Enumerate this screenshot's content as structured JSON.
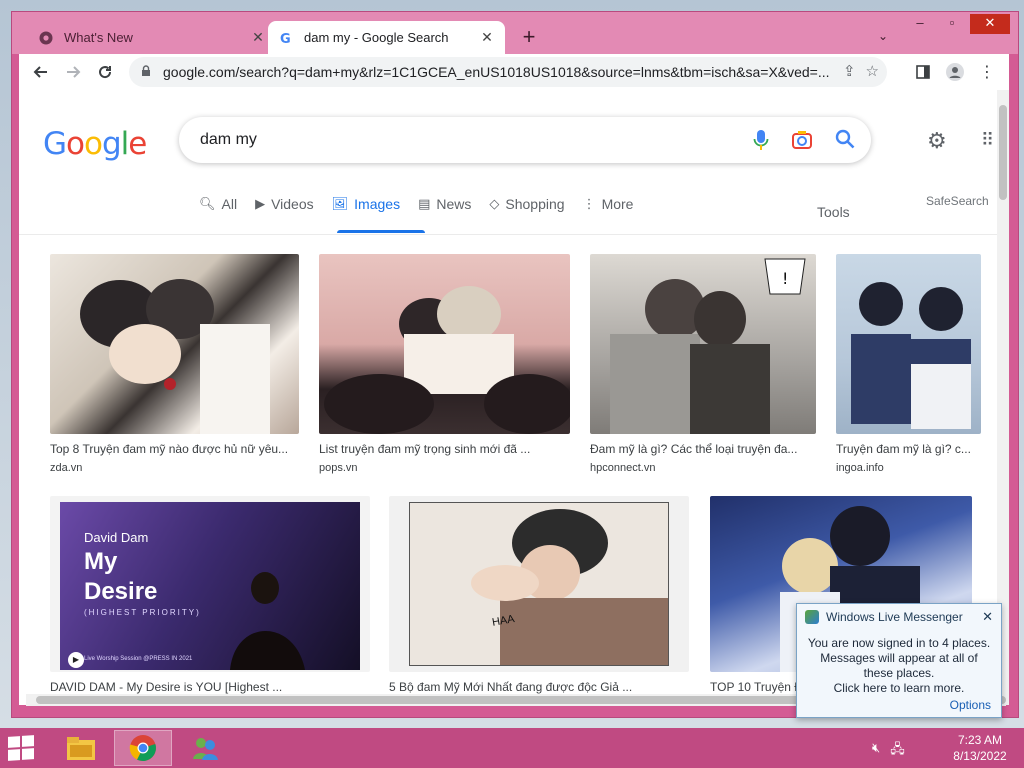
{
  "browser": {
    "tabs": [
      {
        "title": "What's New",
        "active": false
      },
      {
        "title": "dam my - Google Search",
        "active": true
      }
    ],
    "url": "google.com/search?q=dam+my&rlz=1C1GCEA_enUS1018US1018&source=lnms&tbm=isch&sa=X&ved=..."
  },
  "google": {
    "logo": "Google",
    "query": "dam my",
    "tabs": [
      "All",
      "Videos",
      "Images",
      "News",
      "Shopping",
      "More"
    ],
    "active_tab": "Images",
    "tools": "Tools",
    "safesearch": "SafeSearch"
  },
  "results": [
    {
      "caption": "Top 8 Truyện đam mỹ nào được hủ nữ yêu...",
      "source": "zda.vn"
    },
    {
      "caption": "List truyện đam mỹ trọng sinh mới đã ...",
      "source": "pops.vn"
    },
    {
      "caption": "Đam mỹ là gì? Các thể loại truyện đa...",
      "source": "hpconnect.vn"
    },
    {
      "caption": "Truyện đam mỹ là gì? c...",
      "source": "ingoa.info"
    },
    {
      "caption": "DAVID DAM - My Desire is YOU [Highest ...",
      "source": ""
    },
    {
      "caption": "5 Bộ đam Mỹ Mới Nhất đang được độc Giả ...",
      "source": ""
    },
    {
      "caption": "TOP 10 Truyện Đam Mỹ",
      "source": ""
    }
  ],
  "video_thumb": {
    "artist": "David Dam",
    "title_line1": "My",
    "title_line2": "Desire",
    "subtitle": "(HIGHEST PRIORITY)",
    "footer": "Live Worship Session @PRESS IN 2021"
  },
  "manga_bubble": "HAA",
  "messenger": {
    "title": "Windows Live Messenger",
    "message": "You are now signed in to 4 places. Messages will appear at all of these places.",
    "link": "Click here to learn more.",
    "options": "Options"
  },
  "taskbar": {
    "time": "7:23 AM",
    "date": "8/13/2022"
  },
  "colors": {
    "window_frame": "#d45b94",
    "google_blue": "#4285f4",
    "google_red": "#ea4335",
    "google_yellow": "#fbbc05",
    "google_green": "#34a853",
    "active_tab": "#1a73e8"
  }
}
